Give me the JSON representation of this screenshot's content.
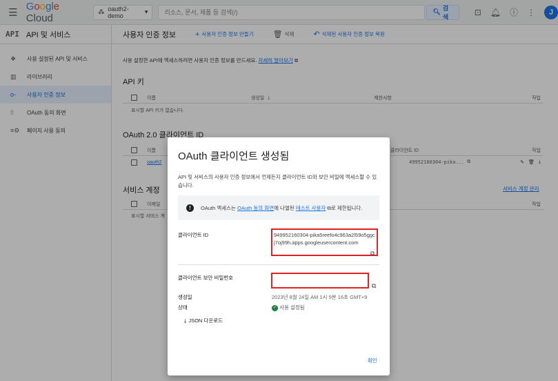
{
  "topbar": {
    "logo_parts": [
      "G",
      "o",
      "o",
      "g",
      "l",
      "e"
    ],
    "logo_suffix": " Cloud",
    "project": "oauth2-demo",
    "search_placeholder": "리소스, 문서, 제품 등 검색(/)",
    "search_button": "검색",
    "avatar_letter": "J"
  },
  "sidebar": {
    "api_label": "API",
    "title": "API 및 서비스",
    "items": [
      {
        "label": "사용 설정된 API 및 서비스",
        "icon": "❖"
      },
      {
        "label": "라이브러리",
        "icon": "▥"
      },
      {
        "label": "사용자 인증 정보",
        "icon": "o-"
      },
      {
        "label": "OAuth 동의 화면",
        "icon": "⁞⁞"
      },
      {
        "label": "페이지 사용 동의",
        "icon": "≡⚙"
      }
    ]
  },
  "main": {
    "title": "사용자 인증 정보",
    "create_label": "사용자 인증 정보 만들기",
    "delete_label": "삭제",
    "restore_label": "삭제된 사용자 인증 정보 복원",
    "intro_text": "사용 설정한 API에 액세스하려면 사용자 인증 정보를 만드세요.",
    "intro_link": "자세히 알아보기",
    "api_keys_title": "API 키",
    "api_cols": {
      "name": "이름",
      "created": "생성일",
      "restrictions": "제한사항",
      "actions": "작업"
    },
    "api_empty": "표시할 API 키가 없습니다.",
    "oauth_title": "OAuth 2.0 클라이언트 ID",
    "oauth_cols": {
      "name": "이름",
      "client_id": "클라이언트 ID",
      "actions": "작업"
    },
    "oauth_row_name": "oauth2",
    "oauth_row_client": "49952160304-pika...",
    "sa_title": "서비스 계정",
    "sa_manage": "서비스 계정 관리",
    "sa_cols": {
      "email": "이메일",
      "actions": "작업"
    },
    "sa_empty": "표시할 서비스 계"
  },
  "dialog": {
    "title": "OAuth 클라이언트 생성됨",
    "description": "API 및 서비스의 사용자 인증 정보에서 언제든지 클라이언트 ID와 보안 비밀에 액세스할 수 있습니다.",
    "info_pre": "OAuth 액세스는",
    "info_link1": "OAuth 동의 화면",
    "info_mid": "에 나열된",
    "info_link2": "테스트 사용자",
    "info_post": "로 제한됩니다.",
    "client_id_label": "클라이언트 ID",
    "client_id_value": "949952160304-pika5reefo4c963a2l59o5ggcj7oj99h.apps.googleusercontent.com",
    "secret_label": "클라이언트 보안 비밀번호",
    "created_label": "생성일",
    "created_value": "2023년 8월 24일 AM 1시 9분 16초 GMT+9",
    "status_label": "상태",
    "status_value": "사용 설정됨",
    "json_download": "JSON 다운로드",
    "confirm": "확인"
  }
}
